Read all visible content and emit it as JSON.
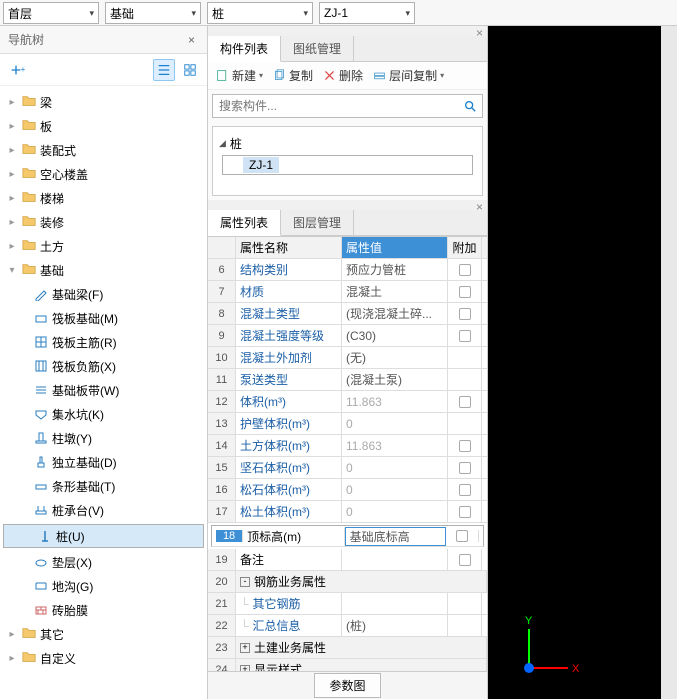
{
  "selectors": {
    "floor": "首层",
    "category": "基础",
    "subtype": "桩",
    "item": "ZJ-1"
  },
  "nav": {
    "title": "导航树",
    "top_nodes": [
      "梁",
      "板",
      "装配式",
      "空心楼盖",
      "楼梯",
      "装修",
      "土方"
    ],
    "expanded_label": "基础",
    "children": [
      {
        "label": "基础梁(F)",
        "icon": "pencil"
      },
      {
        "label": "筏板基础(M)",
        "icon": "slab"
      },
      {
        "label": "筏板主筋(R)",
        "icon": "grid"
      },
      {
        "label": "筏板负筋(X)",
        "icon": "grid2"
      },
      {
        "label": "基础板带(W)",
        "icon": "bars"
      },
      {
        "label": "集水坑(K)",
        "icon": "pit"
      },
      {
        "label": "柱墩(Y)",
        "icon": "pier"
      },
      {
        "label": "独立基础(D)",
        "icon": "iso"
      },
      {
        "label": "条形基础(T)",
        "icon": "strip"
      },
      {
        "label": "桩承台(V)",
        "icon": "cap"
      },
      {
        "label": "桩(U)",
        "icon": "pile",
        "selected": true
      },
      {
        "label": "垫层(X)",
        "icon": "cushion"
      },
      {
        "label": "地沟(G)",
        "icon": "trench"
      },
      {
        "label": "砖胎膜",
        "icon": "brick"
      }
    ],
    "bottom_nodes": [
      "其它",
      "自定义"
    ]
  },
  "component": {
    "tab1": "构件列表",
    "tab2": "图纸管理",
    "new": "新建",
    "copy": "复制",
    "delete": "删除",
    "layercopy": "层间复制",
    "search_placeholder": "搜索构件...",
    "root": "桩",
    "child": "ZJ-1"
  },
  "props": {
    "tab1": "属性列表",
    "tab2": "图层管理",
    "h_name": "属性名称",
    "h_val": "属性值",
    "h_extra": "附加",
    "rows": [
      {
        "n": "6",
        "name": "结构类别",
        "val": "预应力管桩",
        "blue": true,
        "chk": true
      },
      {
        "n": "7",
        "name": "材质",
        "val": "混凝土",
        "blue": true,
        "chk": true
      },
      {
        "n": "8",
        "name": "混凝土类型",
        "val": "(现浇混凝土碎...",
        "blue": true,
        "chk": true
      },
      {
        "n": "9",
        "name": "混凝土强度等级",
        "val": "(C30)",
        "blue": true,
        "chk": true
      },
      {
        "n": "10",
        "name": "混凝土外加剂",
        "val": "(无)",
        "blue": true
      },
      {
        "n": "11",
        "name": "泵送类型",
        "val": "(混凝土泵)",
        "blue": true
      },
      {
        "n": "12",
        "name": "体积(m³)",
        "val": "11.863",
        "blue": true,
        "gray": true,
        "chk": true
      },
      {
        "n": "13",
        "name": "护壁体积(m³)",
        "val": "0",
        "blue": true,
        "gray": true
      },
      {
        "n": "14",
        "name": "土方体积(m³)",
        "val": "11.863",
        "blue": true,
        "gray": true,
        "chk": true
      },
      {
        "n": "15",
        "name": "坚石体积(m³)",
        "val": "0",
        "blue": true,
        "gray": true,
        "chk": true
      },
      {
        "n": "16",
        "name": "松石体积(m³)",
        "val": "0",
        "blue": true,
        "gray": true,
        "chk": true
      },
      {
        "n": "17",
        "name": "松土体积(m³)",
        "val": "0",
        "blue": true,
        "gray": true,
        "chk": true
      },
      {
        "n": "18",
        "name": "顶标高(m)",
        "val": "基础底标高",
        "sel": true,
        "chk": true
      },
      {
        "n": "19",
        "name": "备注",
        "val": "",
        "chk": true
      },
      {
        "n": "20",
        "group": "钢筋业务属性",
        "exp": "-"
      },
      {
        "n": "21",
        "name": "其它钢筋",
        "val": "",
        "blue": true,
        "indent": true
      },
      {
        "n": "22",
        "name": "汇总信息",
        "val": "(桩)",
        "blue": true,
        "indent": true
      },
      {
        "n": "23",
        "group": "土建业务属性",
        "exp": "+"
      },
      {
        "n": "24",
        "group": "显示样式",
        "exp": "+"
      }
    ],
    "param_btn": "参数图"
  },
  "axis": {
    "x": "X",
    "y": "Y"
  }
}
